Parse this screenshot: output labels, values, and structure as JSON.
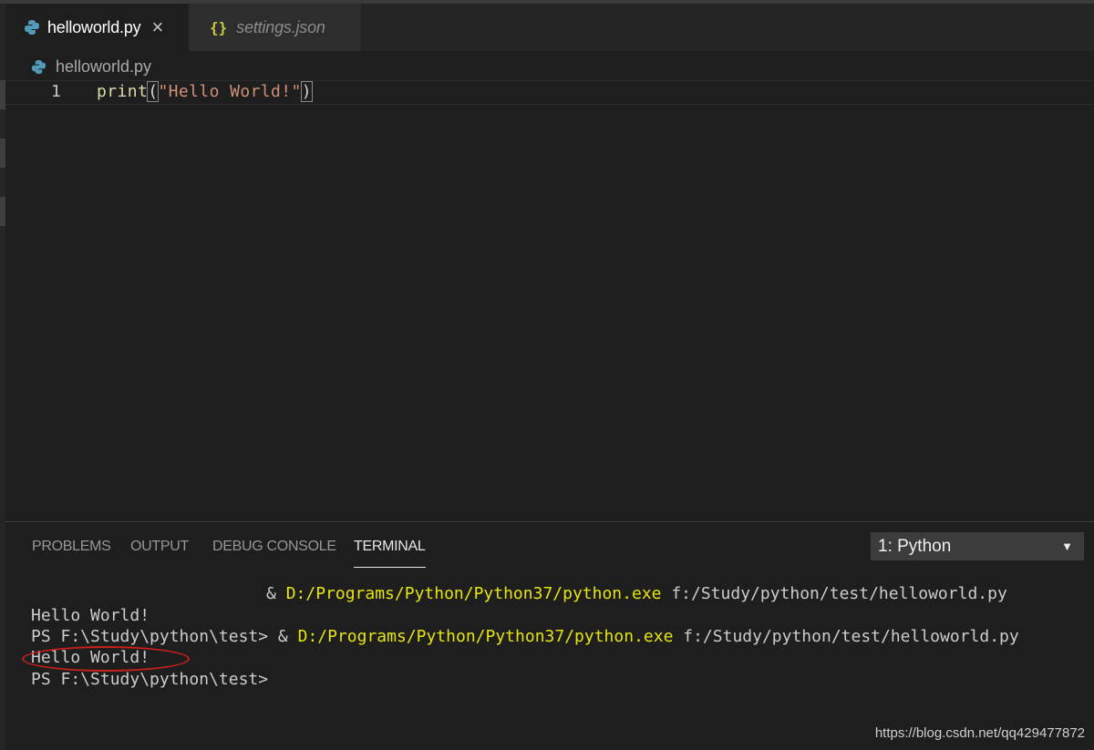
{
  "tabs": [
    {
      "label": "helloworld.py",
      "close_glyph": "×",
      "icon": "python-icon",
      "active": true
    },
    {
      "label": "settings.json",
      "icon_glyph": "{}",
      "icon": "json-braces-icon",
      "active": false
    }
  ],
  "breadcrumb": {
    "label": "helloworld.py",
    "icon": "python-icon"
  },
  "editor": {
    "line_number": "1",
    "code": {
      "fn": "print",
      "open": "(",
      "str": "\"Hello World!\"",
      "close": ")"
    }
  },
  "panel": {
    "tabs": [
      "PROBLEMS",
      "OUTPUT",
      "DEBUG CONSOLE",
      "TERMINAL"
    ],
    "active_tab": "TERMINAL",
    "terminal_select": "1: Python",
    "caret_glyph": "▼"
  },
  "terminal": {
    "line1": {
      "prefix": "& ",
      "exe": "D:/Programs/Python/Python37/python.exe",
      "arg": " f:/Study/python/test/helloworld.py"
    },
    "line2": "Hello World!",
    "line3": {
      "prefix": "PS F:\\Study\\python\\test> & ",
      "exe": "D:/Programs/Python/Python37/python.exe",
      "arg": " f:/Study/python/test/helloworld.py"
    },
    "line4": "Hello World!",
    "line5": "PS F:\\Study\\python\\test>"
  },
  "watermark": "https://blog.csdn.net/qq429477872",
  "colors": {
    "background": "#1e1e1e",
    "tab_bar": "#252526",
    "string": "#ce9178",
    "function": "#dcdcaa",
    "terminal_yellow": "#e5e510",
    "annotation_red": "#c8201a"
  }
}
